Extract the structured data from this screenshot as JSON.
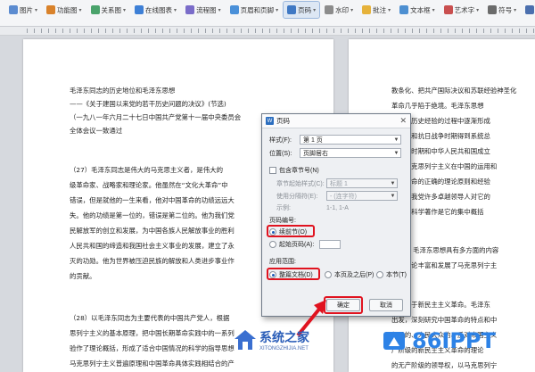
{
  "ribbon": {
    "items": [
      {
        "label": "图片",
        "color": "#5b8bd0"
      },
      {
        "label": "功能图",
        "color": "#d9822b"
      },
      {
        "label": "关系图",
        "color": "#4aa36b"
      },
      {
        "label": "在线图表",
        "color": "#3d7fd6"
      },
      {
        "label": "流程图",
        "color": "#7a6cc9"
      },
      {
        "label": "页眉和页脚",
        "color": "#4a90d9"
      },
      {
        "label": "页码",
        "color": "#3f78c4"
      },
      {
        "label": "水印",
        "color": "#8c8c8c"
      },
      {
        "label": "批注",
        "color": "#e6b23a"
      },
      {
        "label": "文本框",
        "color": "#4d8fd1"
      },
      {
        "label": "艺术字",
        "color": "#c94f4f"
      },
      {
        "label": "符号",
        "color": "#6b6b6b"
      },
      {
        "label": "公式",
        "color": "#4b6fae"
      },
      {
        "label": "首字下沉",
        "color": "#777777"
      },
      {
        "label": "插入数字",
        "color": "#5a8fd6"
      },
      {
        "label": "文档部件",
        "color": "#3f7bc9"
      }
    ],
    "active_color": "#dde7f4"
  },
  "left_page": {
    "lines": [
      "毛泽东同志的历史地位和毛泽东思想",
      "——《关于建国以来党的若干历史问题的决议》(节选)",
      "（一九八一年六月二十七日中国共产党第十一届中央委员会",
      "全体会议一致通过",
      "（27）毛泽东同志是伟大的马克思主义者，是伟大的",
      "级革命家、战略家和理论家。他虽然在“文化大革命”中",
      "错误，但是就他的一生来看，他对中国革命的功绩远远大",
      "失。他的功绩是第一位的，错误是第二位的。他为我们党",
      "民解放军的创立和发展，为中国各族人民解放事业的胜利",
      "人民共和国的缔造和我国社会主义事业的发展，建立了永",
      "灭的功勋。他为世界被压迫民族的解放和人类进步事业作",
      "的贡献。",
      "（28）以毛泽东同志为主要代表的中国共产党人，根据",
      "思列宁主义的基本原理，把中国长期革命实践中的一系列",
      "验作了理论概括，形成了适合中国情况的科学的指导思想",
      "马克思列宁主义普遍原理和中国革命具体实践相结合的产"
    ]
  },
  "right_page": {
    "lines": [
      "教条化、把共产国际决议和苏联经验神圣化",
      "革命几乎陷于绝境。毛泽东思想",
      "方面的历史经验的过程中逐渐形成",
      "争后期和抗日战争时期得到系统总",
      "放战争时期和中华人民共和国成立",
      "想是马克思列宁主义在中国的运用和",
      "中国革命的正确的理论原则和经验",
      "结晶。我党许多卓越领导人对它的",
      "泽东的科学著作是它的集中概括",
      "（29）毛泽东思想具有多方面的内容",
      "性的理论丰富和发展了马克思列宁主",
      "一、关于新民主主义革命。毛泽东",
      "出发，深刻研究中国革命的特点和中",
      "领导的、人民大众的、反对帝国主义",
      "产阶级的新民主主义革命的理论",
      "的无产阶级的领导权，以马克思列宁"
    ]
  },
  "dialog": {
    "title": "页码",
    "close_label": "✕",
    "style_label": "样式(F):",
    "style_value": "第 1 页",
    "position_label": "位置(S):",
    "position_value": "页脚居右",
    "include_chapter_label": "包含章节号(N)",
    "chapter_start_label": "章节起始样式(C):",
    "chapter_start_value": "标题 1",
    "separator_label": "使用分隔符(E):",
    "separator_value": "- (连字符)",
    "example_label": "示例:",
    "example_value": "1-1, 1-A",
    "numbering_label": "页码编号:",
    "continue_label": "续前节(O)",
    "start_at_label": "起始页码(A):",
    "apply_label": "应用范围:",
    "apply_whole_label": "整篇文档(D)",
    "apply_after_label": "本页及之后(P)",
    "apply_section_label": "本节(T)",
    "ok_label": "确定",
    "cancel_label": "取消",
    "highlight_color": "#e0131f"
  },
  "watermark": {
    "left_text": "系统之家",
    "left_sub": "XITONGZHIJIA.NET",
    "right_text": "86IPPT"
  }
}
